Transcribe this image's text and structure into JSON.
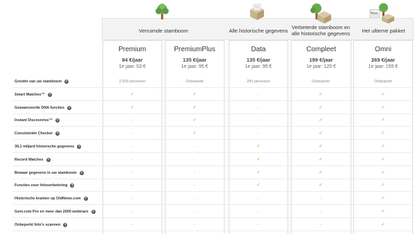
{
  "categories": [
    {
      "label": "Verruimde stamboom"
    },
    {
      "label": "Alle historische gegevens"
    },
    {
      "label": "Verbeterde stamboom en alle historische gegevens"
    },
    {
      "label": "Het ultieme pakket"
    }
  ],
  "plans": [
    {
      "name": "Premium",
      "price": "84 €/jaar",
      "first_year": "1e jaar: 53 €"
    },
    {
      "name": "PremiumPlus",
      "price": "135 €/jaar",
      "first_year": "1e jaar: 95 €"
    },
    {
      "name": "Data",
      "price": "135 €/jaar",
      "first_year": "1e jaar: 95 €"
    },
    {
      "name": "Compleet",
      "price": "199 €/jaar",
      "first_year": "1e jaar: 125 €"
    },
    {
      "name": "Omni",
      "price": "269 €/jaar",
      "first_year": "1e jaar: 155 €"
    }
  ],
  "help_glyph": "?",
  "check_glyph": "✓",
  "dash_glyph": "–",
  "colors": {
    "check": "#86b83c",
    "tree_green": "#6aa84f"
  },
  "features": [
    {
      "label": "Grootte van uw stamboom",
      "values": [
        "2.500 personen",
        "Onbeperkt",
        "250 personen",
        "Onbeperkt",
        "Onbeperkt"
      ]
    },
    {
      "label": "Smart Matches™",
      "values": [
        "check",
        "check",
        "dash",
        "check",
        "check"
      ]
    },
    {
      "label": "Geavanceerde DNA functies",
      "values": [
        "check",
        "check",
        "dash",
        "check",
        "check"
      ]
    },
    {
      "label": "Instant Discoveries™",
      "values": [
        "dash",
        "check",
        "dash",
        "check",
        "check"
      ]
    },
    {
      "label": "Consistentie Checker",
      "values": [
        "dash",
        "check",
        "dash",
        "check",
        "check"
      ]
    },
    {
      "label": "39,1 miljard historische gegevens",
      "values": [
        "dash",
        "dash",
        "check",
        "check",
        "check"
      ]
    },
    {
      "label": "Record Matches",
      "values": [
        "dash",
        "dash",
        "check",
        "check",
        "check"
      ]
    },
    {
      "label": "Bewaar gegevens in uw stamboom",
      "values": [
        "dash",
        "dash",
        "check",
        "check",
        "check"
      ]
    },
    {
      "label": "Functies voor fotoverbetering",
      "values": [
        "dash",
        "dash",
        "check",
        "check",
        "check"
      ]
    },
    {
      "label": "Historische kranten op OldNews.com",
      "values": [
        "dash",
        "dash",
        "dash",
        "dash",
        "check"
      ]
    },
    {
      "label": "Geni.com Pro en meer dan 2000 webinars",
      "values": [
        "dash",
        "dash",
        "dash",
        "dash",
        "check"
      ]
    },
    {
      "label": "Onbeperkt foto's scannen",
      "values": [
        "dash",
        "dash",
        "dash",
        "dash",
        "check"
      ]
    }
  ],
  "news_label": "News"
}
